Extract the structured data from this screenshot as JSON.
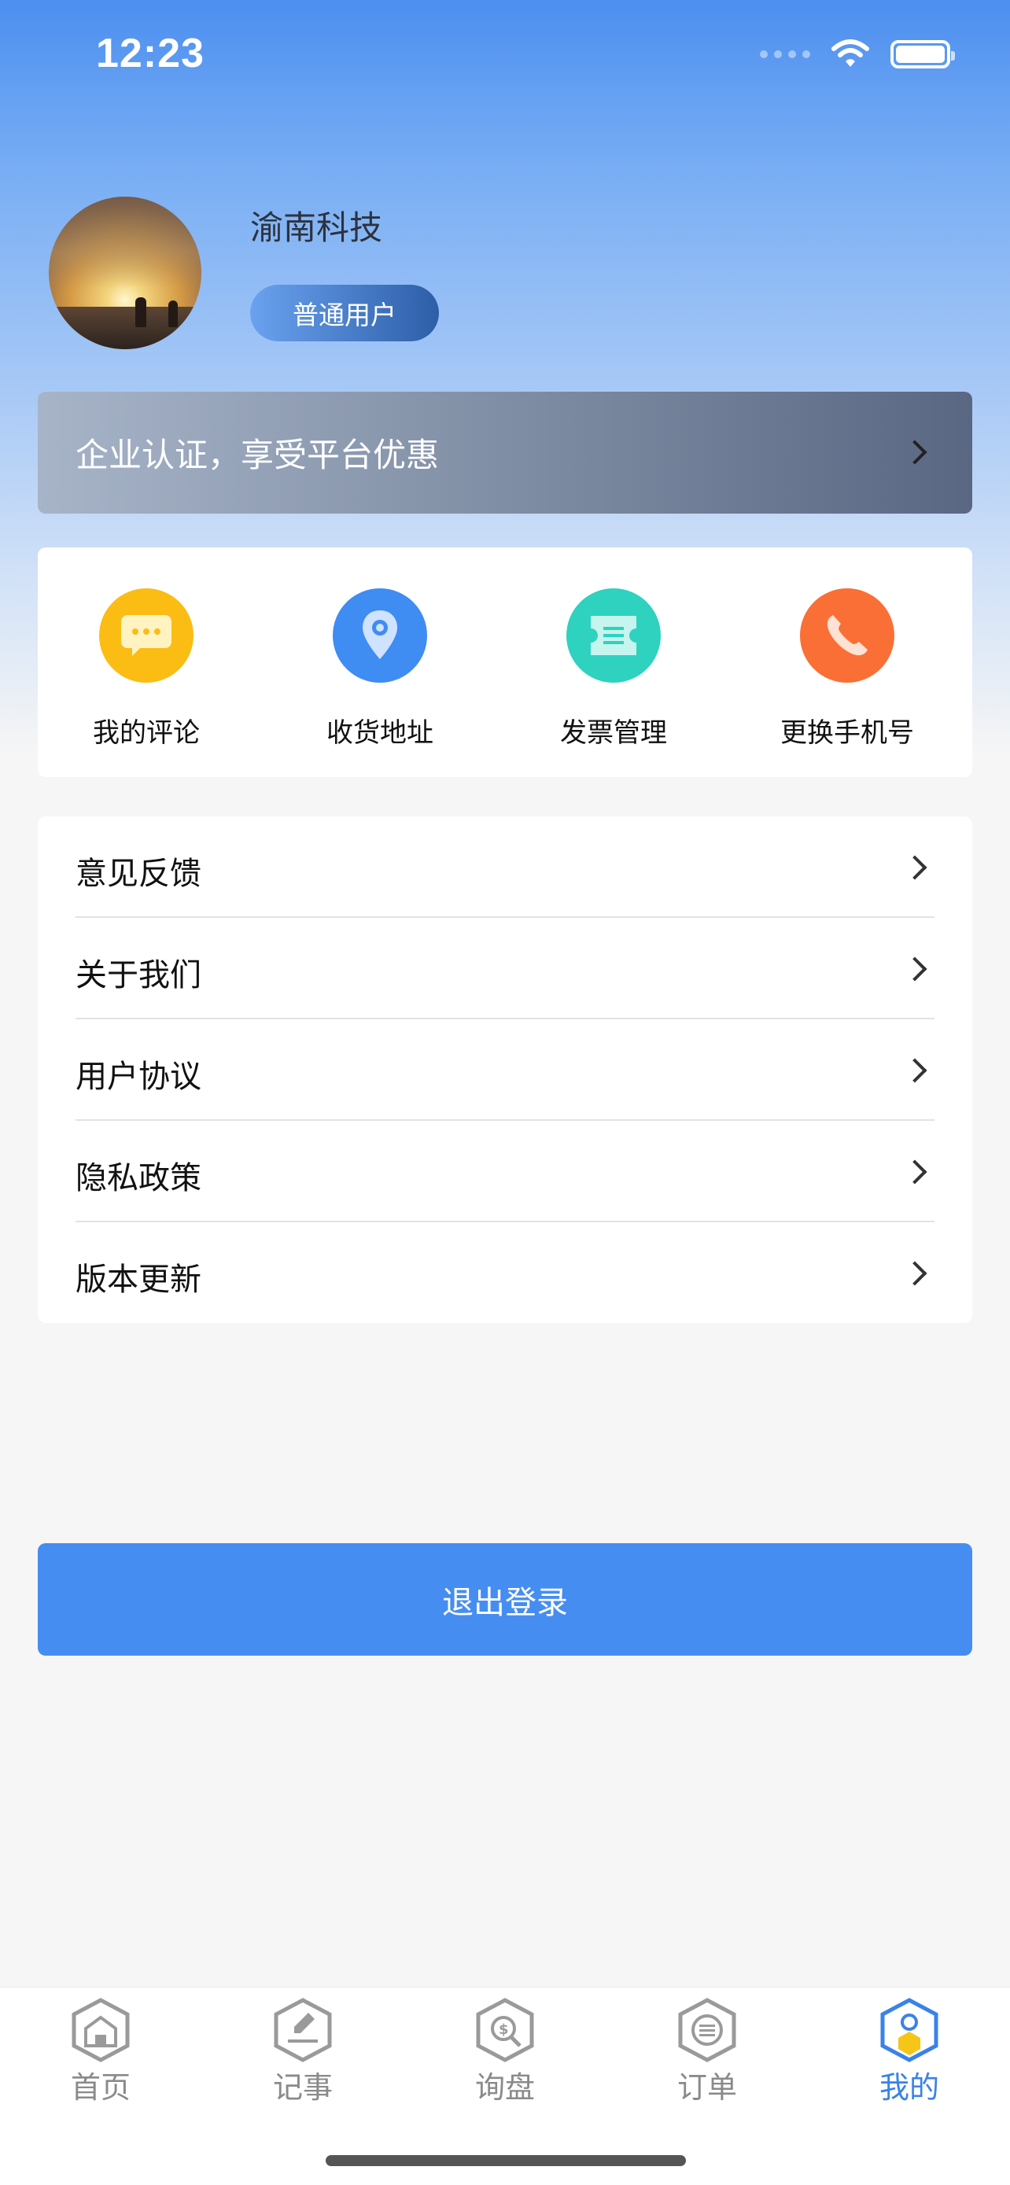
{
  "status_bar": {
    "time": "12:23"
  },
  "profile": {
    "name": "渝南科技",
    "badge": "普通用户"
  },
  "cert_banner": {
    "text": "企业认证，享受平台优惠"
  },
  "quick_actions": [
    {
      "label": "我的评论",
      "icon": "comment-icon",
      "color": "#fbbd14"
    },
    {
      "label": "收货地址",
      "icon": "location-pin-icon",
      "color": "#3f8cf3"
    },
    {
      "label": "发票管理",
      "icon": "invoice-icon",
      "color": "#2ed2bf"
    },
    {
      "label": "更换手机号",
      "icon": "phone-icon",
      "color": "#fa6f35"
    }
  ],
  "menu": {
    "items": [
      {
        "label": "意见反馈"
      },
      {
        "label": "关于我们"
      },
      {
        "label": "用户协议"
      },
      {
        "label": "隐私政策"
      },
      {
        "label": "版本更新"
      }
    ]
  },
  "logout_label": "退出登录",
  "tabs": [
    {
      "label": "首页",
      "icon": "home-icon"
    },
    {
      "label": "记事",
      "icon": "notes-icon"
    },
    {
      "label": "询盘",
      "icon": "inquiry-icon"
    },
    {
      "label": "订单",
      "icon": "orders-icon"
    },
    {
      "label": "我的",
      "icon": "profile-icon",
      "active": true
    }
  ],
  "colors": {
    "accent": "#468df2",
    "tab_active": "#3a82ea",
    "tab_inactive": "#8a8a8a"
  }
}
